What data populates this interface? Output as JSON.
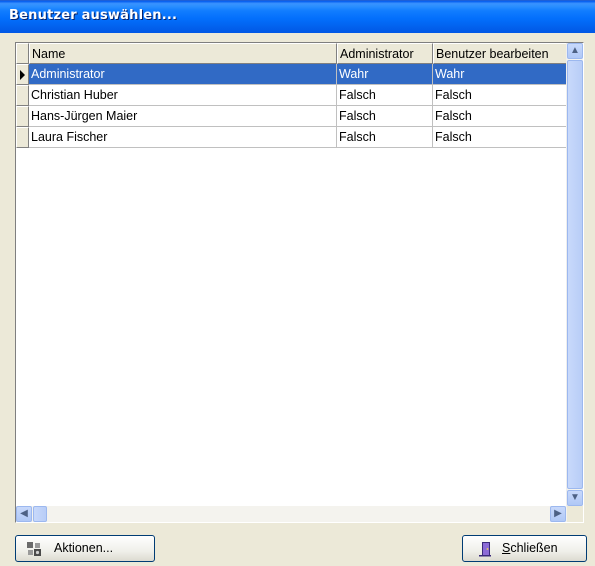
{
  "window": {
    "title": "Benutzer auswählen..."
  },
  "grid": {
    "columns": [
      "Name",
      "Administrator",
      "Benutzer bearbeiten"
    ],
    "rows": [
      {
        "name": "Administrator",
        "admin": "Wahr",
        "edit": "Wahr",
        "selected": true
      },
      {
        "name": "Christian Huber",
        "admin": "Falsch",
        "edit": "Falsch",
        "selected": false
      },
      {
        "name": "Hans-Jürgen Maier",
        "admin": "Falsch",
        "edit": "Falsch",
        "selected": false
      },
      {
        "name": "Laura Fischer",
        "admin": "Falsch",
        "edit": "Falsch",
        "selected": false
      }
    ]
  },
  "buttons": {
    "actions_label": "Aktionen...",
    "close_prefix": "",
    "close_mnemonic": "S",
    "close_rest": "chließen"
  },
  "colors": {
    "selection": "#316ac5",
    "titlebar": "#0a5fe8"
  }
}
